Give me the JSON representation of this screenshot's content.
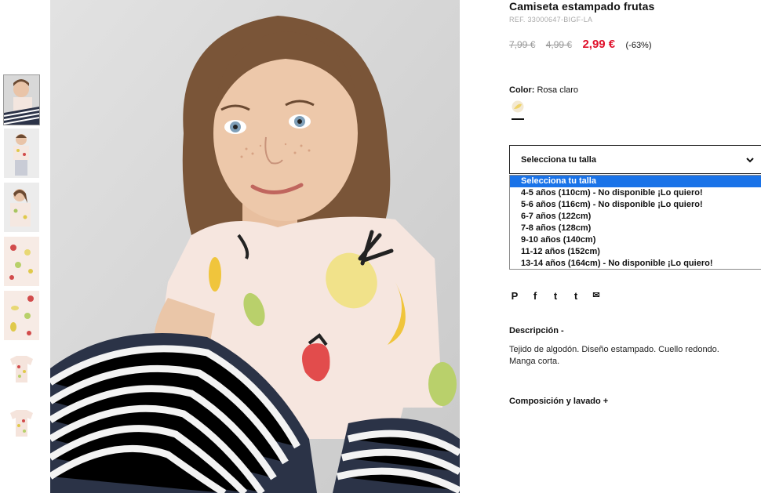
{
  "product": {
    "title": "Camiseta estampado frutas",
    "ref": "REF. 33000647-BIGF-LA",
    "price_old_1": "7,99 €",
    "price_old_2": "4,99 €",
    "price_now": "2,99 €",
    "discount": "(-63%)"
  },
  "color": {
    "label": "Color:",
    "value": "Rosa claro"
  },
  "size_select": {
    "placeholder": "Selecciona tu talla",
    "options": [
      "Selecciona tu talla",
      "4-5 años (110cm) - No disponible ¡Lo quiero!",
      "5-6 años (116cm) - No disponible ¡Lo quiero!",
      "6-7 años (122cm)",
      "7-8 años (128cm)",
      "9-10 años (140cm)",
      "11-12 años (152cm)",
      "13-14 años (164cm) - No disponible ¡Lo quiero!"
    ]
  },
  "share": {
    "pinterest": "P",
    "facebook": "f",
    "twitter": "t",
    "tumblr": "t",
    "email": "✉"
  },
  "description": {
    "heading": "Descripción -",
    "text": "Tejido de algodón. Diseño estampado. Cuello redondo. Manga corta."
  },
  "composition": {
    "heading": "Composición y lavado +"
  },
  "colors": {
    "price_now": "#e0112b",
    "highlight": "#1a73e8"
  }
}
